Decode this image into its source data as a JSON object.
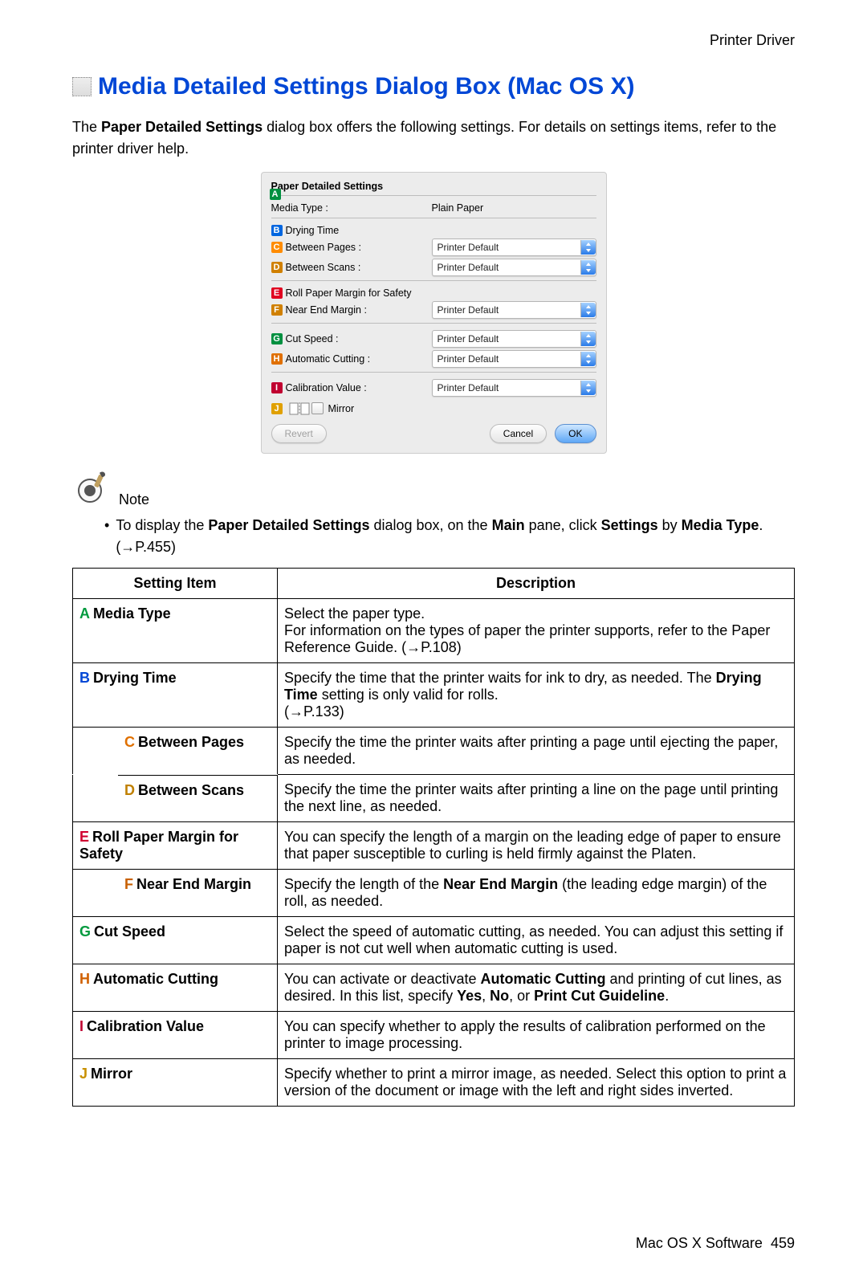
{
  "header": {
    "section": "Printer Driver"
  },
  "title": "Media Detailed Settings Dialog Box (Mac OS X)",
  "intro": {
    "pre": "The ",
    "bold": "Paper Detailed Settings",
    "post": " dialog box offers the following settings.  For details on settings items, refer to the printer driver help."
  },
  "shot": {
    "caption": "Paper Detailed Settings",
    "media_type_label": "Media Type :",
    "media_type_value": "Plain Paper",
    "drying_time_header": "Drying Time",
    "between_pages_label": "Between Pages :",
    "between_scans_label": "Between Scans :",
    "roll_margin_header": "Roll Paper Margin for Safety",
    "near_end_label": "Near End Margin :",
    "cut_speed_label": "Cut Speed :",
    "auto_cut_label": "Automatic Cutting :",
    "calib_label": "Calibration Value :",
    "mirror_label": "Mirror",
    "select_default": "Printer Default",
    "revert": "Revert",
    "cancel": "Cancel",
    "ok": "OK"
  },
  "note": {
    "label": "Note",
    "bullet": "•",
    "t1": "To display the ",
    "b1": "Paper Detailed Settings",
    "t2": " dialog box, on the ",
    "b2": "Main",
    "t3": " pane, click ",
    "b3": "Settings",
    "t4": " by ",
    "b4": "Media Type",
    "t5": ".  (→P.455)"
  },
  "table": {
    "h_setting": "Setting Item",
    "h_desc": "Description",
    "rows": {
      "a": {
        "label": "Media Type",
        "d1": "Select the paper type.",
        "d2": "For information on the types of paper the printer supports, refer to the Paper Reference Guide.  (→P.108)"
      },
      "b": {
        "label": "Drying Time",
        "d1": "Specify the time that the printer waits for ink to dry, as needed.  The ",
        "bold": "Drying Time",
        "d2": " setting is only valid for rolls.",
        "d3": "(→P.133)"
      },
      "c": {
        "label": "Between Pages",
        "d": "Specify the time the printer waits after printing a page until ejecting the paper, as needed."
      },
      "d": {
        "label": "Between Scans",
        "d": "Specify the time the printer waits after printing a line on the page until printing the next line, as needed."
      },
      "e": {
        "label": "Roll Paper Margin for Safety",
        "d": "You can specify the length of a margin on the leading edge of paper to ensure that paper susceptible to curling is held firmly against the Platen."
      },
      "f": {
        "label": "Near End Margin",
        "d1": "Specify the length of the ",
        "bold": "Near End Margin",
        "d2": " (the leading edge margin) of the roll, as needed."
      },
      "g": {
        "label": "Cut Speed",
        "d": "Select the speed of automatic cutting, as needed.  You can adjust this setting if paper is not cut well when automatic cutting is used."
      },
      "h": {
        "label": "Automatic Cutting",
        "d1": "You can activate or deactivate ",
        "bold1": "Automatic Cutting",
        "d2": " and printing of cut lines, as desired.  In this list, specify ",
        "bold2": "Yes",
        "d3": ", ",
        "bold3": "No",
        "d4": ", or ",
        "bold4": "Print Cut Guideline",
        "d5": "."
      },
      "i": {
        "label": "Calibration Value",
        "d": "You can specify whether to apply the results of calibration performed on the printer to image processing."
      },
      "j": {
        "label": "Mirror",
        "d": "Specify whether to print a mirror image, as needed.  Select this option to print a version of the document or image with the left and right sides inverted."
      }
    }
  },
  "footer": {
    "label": "Mac OS X Software",
    "page": "459"
  }
}
